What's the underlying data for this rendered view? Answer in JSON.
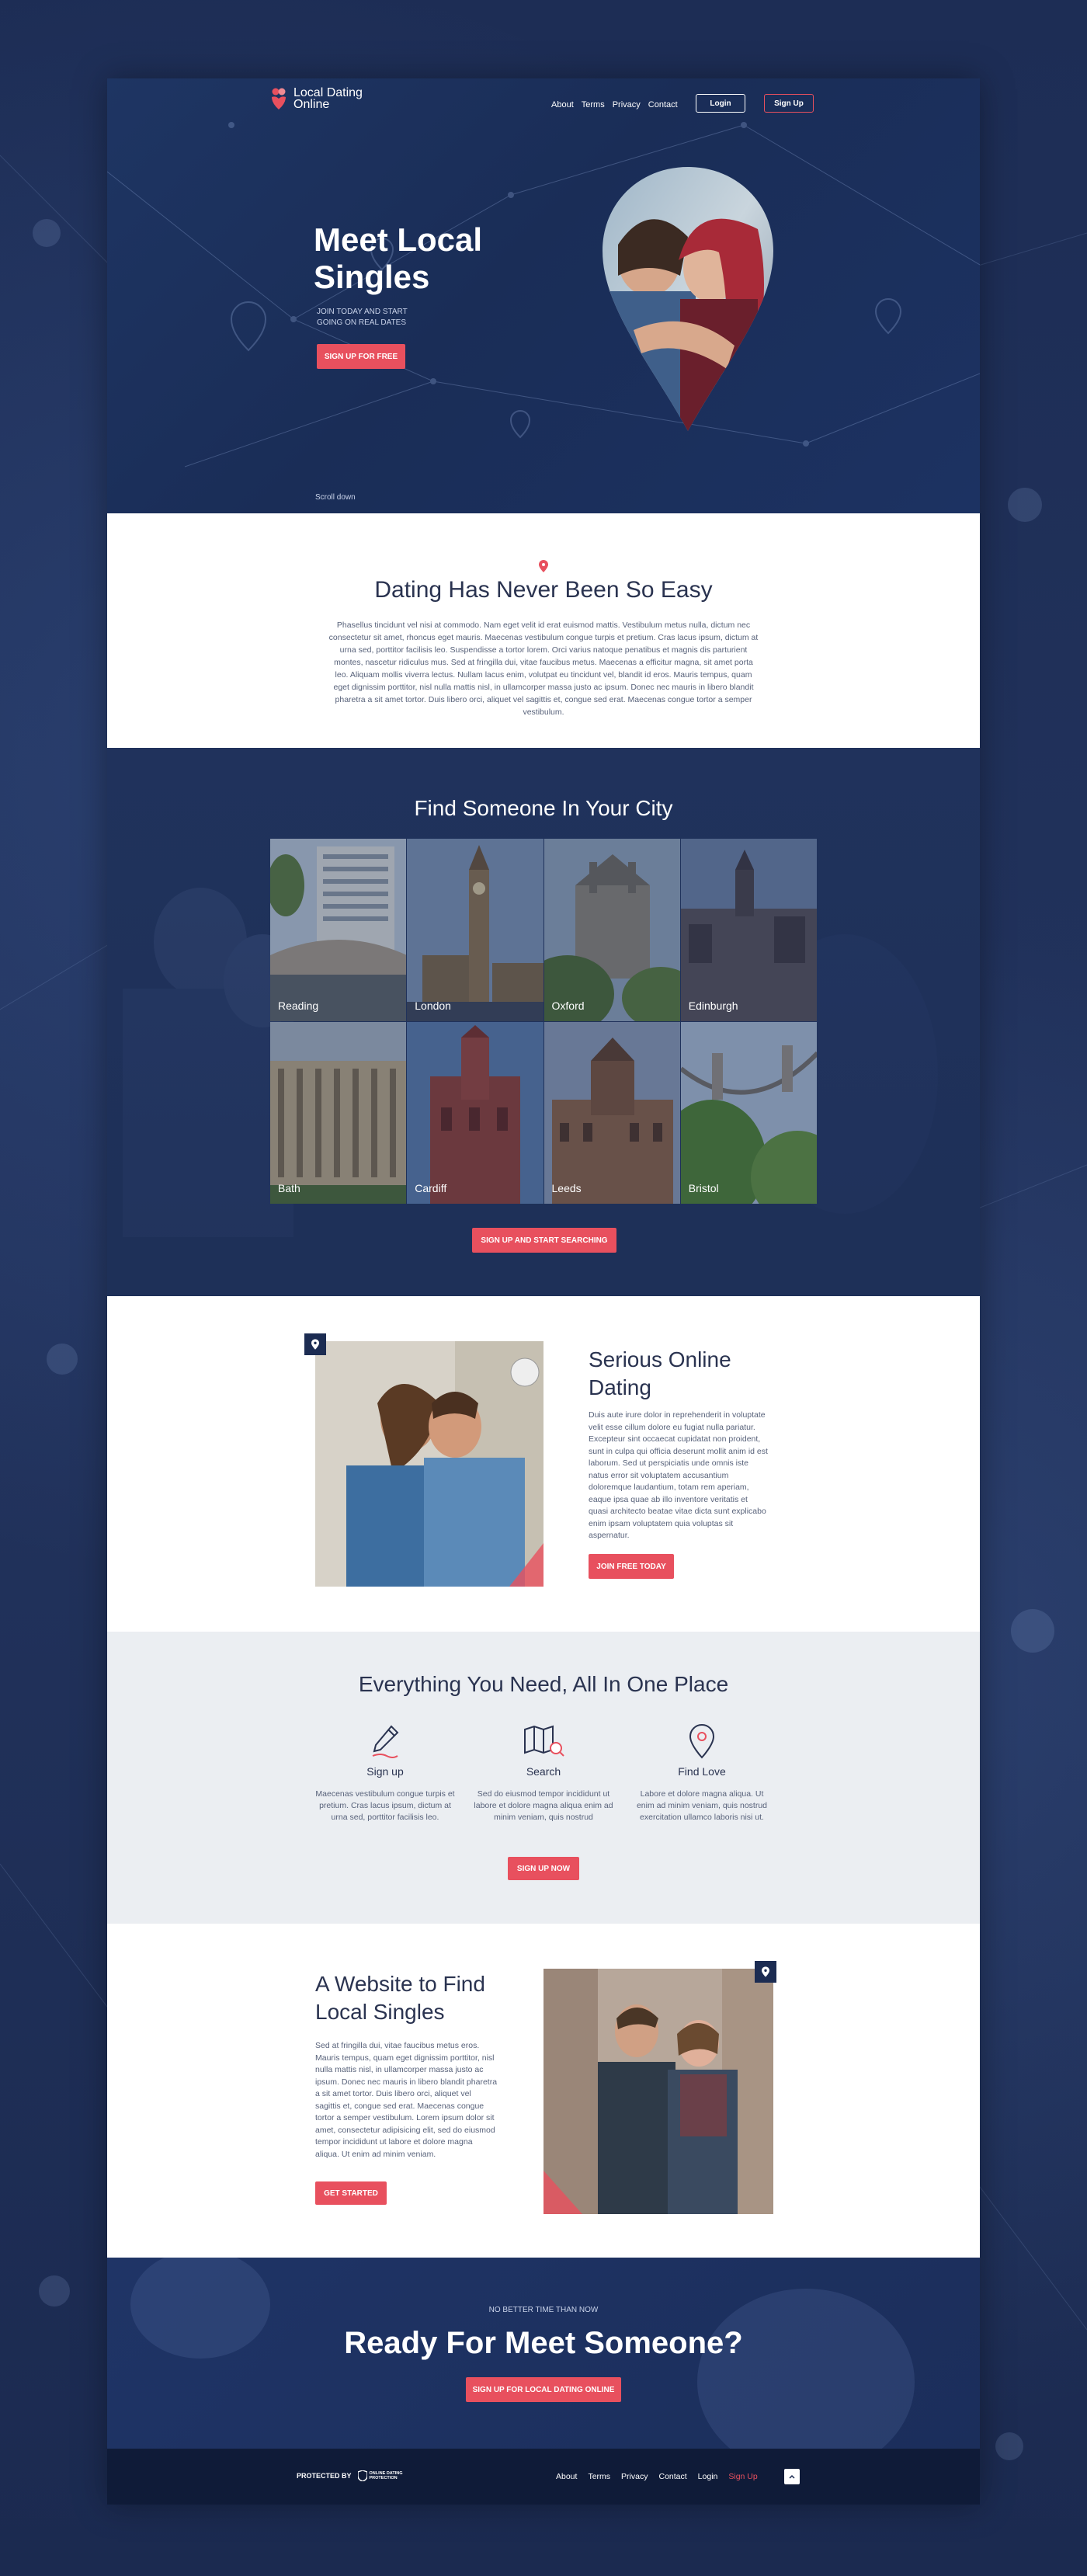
{
  "nav": {
    "logo_text": "Local Dating Online",
    "links": [
      "About",
      "Terms",
      "Privacy",
      "Contact"
    ],
    "login": "Login",
    "signup": "Sign Up"
  },
  "hero": {
    "title": "Meet Local Singles",
    "subtitle": "JOIN TODAY AND START GOING ON REAL DATES",
    "cta": "SIGN UP FOR FREE",
    "scroll": "Scroll down"
  },
  "easy": {
    "title": "Dating Has Never Been So Easy",
    "body": "Phasellus tincidunt vel nisi at commodo. Nam eget velit id erat euismod mattis. Vestibulum metus nulla, dictum nec consectetur sit amet, rhoncus eget mauris. Maecenas vestibulum congue turpis et pretium. Cras lacus ipsum, dictum at urna sed, porttitor facilisis leo. Suspendisse a tortor lorem. Orci varius natoque penatibus et magnis dis parturient montes, nascetur ridiculus mus. Sed at fringilla dui, vitae faucibus metus. Maecenas a efficitur magna, sit amet porta leo. Aliquam mollis viverra lectus. Nullam lacus enim, volutpat eu tincidunt vel, blandit id eros. Mauris tempus, quam eget dignissim porttitor, nisl nulla mattis nisl, in ullamcorper massa justo ac ipsum. Donec nec mauris in libero blandit pharetra a sit amet tortor. Duis libero orci, aliquet vel sagittis et, congue sed erat. Maecenas congue tortor a semper vestibulum."
  },
  "city": {
    "title": "Find Someone In Your City",
    "cities": [
      "Reading",
      "London",
      "Oxford",
      "Edinburgh",
      "Bath",
      "Cardiff",
      "Leeds",
      "Bristol"
    ],
    "cta": "SIGN UP AND START SEARCHING"
  },
  "serious": {
    "title": "Serious Online Dating",
    "body": "Duis aute irure dolor in reprehenderit in voluptate velit esse cillum dolore eu fugiat nulla pariatur. Excepteur sint occaecat cupidatat non proident, sunt in culpa qui officia deserunt mollit anim id est laborum. Sed ut perspiciatis unde omnis iste natus error sit voluptatem accusantium doloremque laudantium, totam rem aperiam, eaque ipsa quae ab illo inventore veritatis et quasi architecto beatae vitae dicta sunt explicabo enim ipsam voluptatem quia voluptas sit aspernatur.",
    "cta": "JOIN FREE TODAY"
  },
  "features": {
    "title": "Everything You Need, All In One Place",
    "items": [
      {
        "title": "Sign up",
        "text": "Maecenas vestibulum congue turpis et pretium. Cras lacus ipsum, dictum at urna sed, porttitor facilisis leo.",
        "icon": "pen-icon"
      },
      {
        "title": "Search",
        "text": "Sed do eiusmod tempor incididunt ut labore et dolore magna aliqua enim ad minim veniam, quis nostrud",
        "icon": "map-search-icon"
      },
      {
        "title": "Find Love",
        "text": "Labore et dolore magna aliqua. Ut enim ad minim veniam, quis nostrud exercitation ullamco laboris nisi ut.",
        "icon": "location-pin-icon"
      }
    ],
    "cta": "SIGN UP NOW"
  },
  "website": {
    "title": "A Website to Find Local Singles",
    "body": "Sed at fringilla dui, vitae faucibus metus eros. Mauris tempus, quam eget dignissim porttitor, nisl nulla mattis nisl, in ullamcorper massa justo ac ipsum. Donec nec mauris in libero blandit pharetra a sit amet tortor. Duis libero orci, aliquet vel sagittis et, congue sed erat. Maecenas congue tortor a semper vestibulum. Lorem ipsum dolor sit amet, consectetur adipisicing elit, sed do eiusmod tempor incididunt ut labore et dolore magna aliqua. Ut enim ad minim veniam.",
    "cta": "GET STARTED"
  },
  "ready": {
    "small": "NO BETTER TIME THAN NOW",
    "title": "Ready For Meet Someone?",
    "cta": "SIGN UP FOR LOCAL DATING ONLINE"
  },
  "footer": {
    "protected": "PROTECTED BY",
    "badge_text": "ONLINE DATING PROTECTION",
    "links": [
      "About",
      "Terms",
      "Privacy",
      "Contact",
      "Login",
      "Sign Up"
    ]
  },
  "colors": {
    "navy": "#1c2c52",
    "accent": "#e8505e",
    "light_gray": "#ebeef2"
  }
}
